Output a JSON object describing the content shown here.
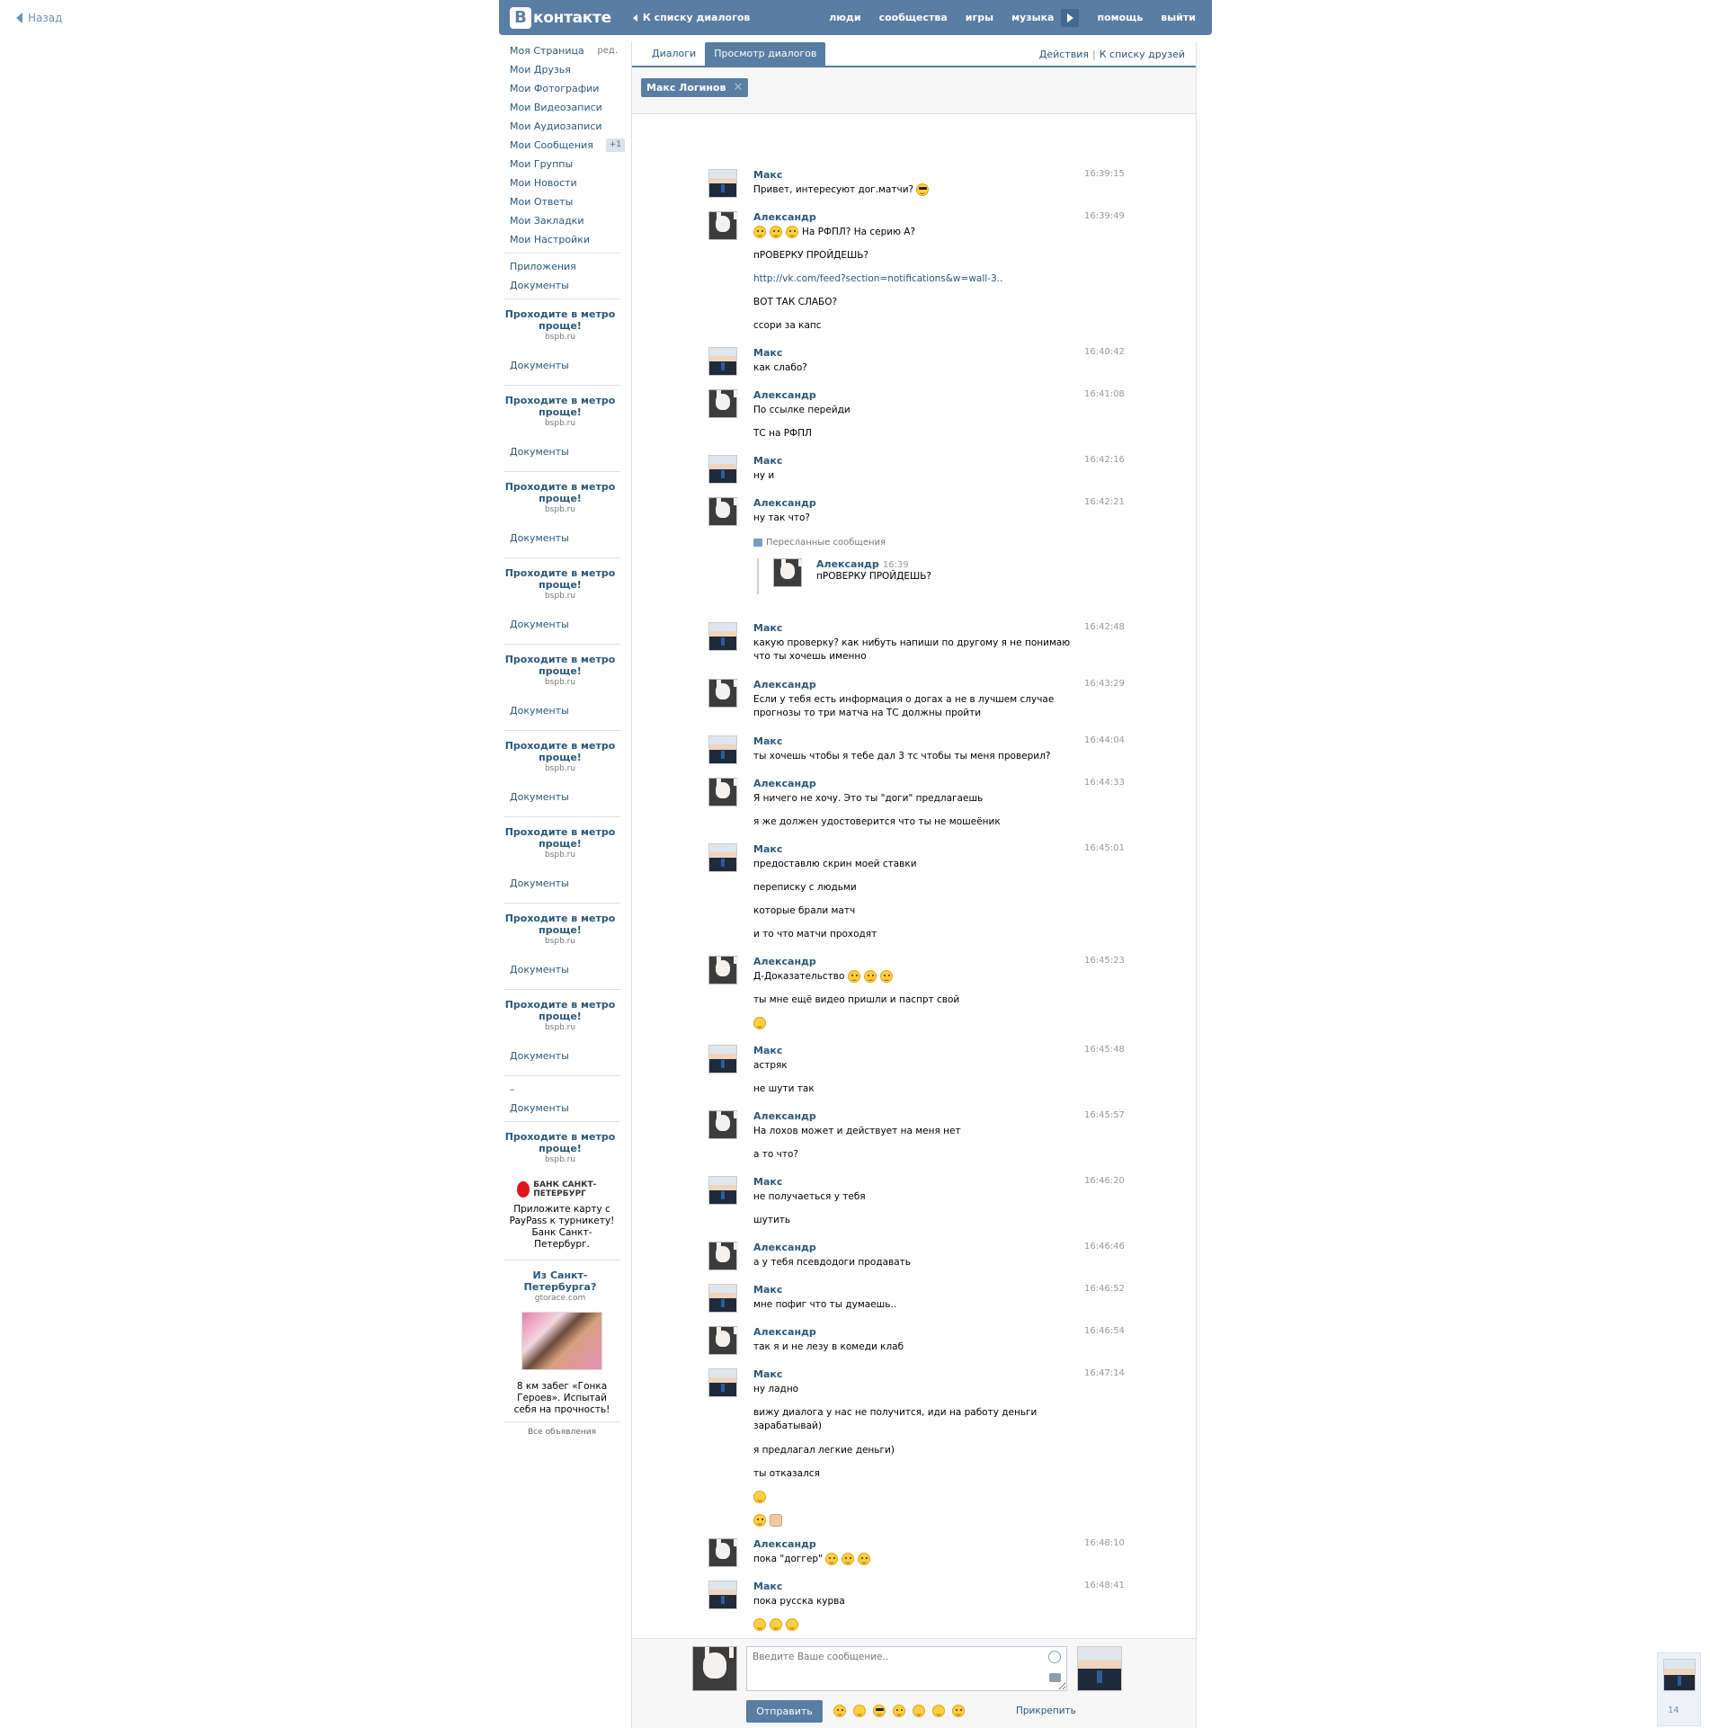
{
  "back": {
    "label": "Назад"
  },
  "header": {
    "logo_b": "В",
    "logo_text": "контакте",
    "crumb": "К списку диалогов",
    "nav": [
      "люди",
      "сообщества",
      "игры",
      "музыка",
      "помощь",
      "выйти"
    ]
  },
  "sidebar": {
    "items": [
      {
        "label": "Моя Страница",
        "extra": "ред."
      },
      {
        "label": "Мои Друзья"
      },
      {
        "label": "Мои Фотографии"
      },
      {
        "label": "Мои Видеозаписи"
      },
      {
        "label": "Мои Аудиозаписи"
      },
      {
        "label": "Мои Сообщения",
        "badge": "+1"
      },
      {
        "label": "Мои Группы"
      },
      {
        "label": "Мои Новости"
      },
      {
        "label": "Мои Ответы"
      },
      {
        "label": "Мои Закладки"
      },
      {
        "label": "Мои Настройки"
      }
    ],
    "extra_items": [
      "Приложения",
      "Документы"
    ],
    "ad_title": "Проходите в метро проще!",
    "ad_domain": "bspb.ru",
    "docs_label": "Документы",
    "dash": "–",
    "bank_name": "БАНК САНКТ-ПЕТЕРБУРГ",
    "bank_text": "Приложите карту с PayPass к турникету! Банк Санкт-Петербург.",
    "ad2_title": "Из Санкт-Петербурга?",
    "ad2_domain": "gtorace.com",
    "ad2_text": "8 км забег «Гонка Героев». Испытай себя на прочность!",
    "all_ads": "Все объявления"
  },
  "tabs": {
    "dialogs": "Диалоги",
    "view": "Просмотр диалогов",
    "actions": "Действия",
    "friends": "К списку друзей",
    "sep": "|"
  },
  "peer": {
    "name": "Макс Логинов",
    "close": "✕"
  },
  "messages": [
    {
      "author": "Макс",
      "time": "16:39:15",
      "lines": [
        "Привет, интересуют дог.матчи?"
      ]
    },
    {
      "author": "Александр",
      "time": "16:39:49",
      "lines": [
        "На РФПЛ? На серию А?",
        "пРОВЕРКУ ПРОЙДЕШЬ?",
        "http://vk.com/feed?section=notifications&w=wall-3..",
        "ВОТ ТАК СЛАБО?",
        "ссори за капс"
      ]
    },
    {
      "author": "Макс",
      "time": "16:40:42",
      "lines": [
        "как слабо?"
      ]
    },
    {
      "author": "Александр",
      "time": "16:41:08",
      "lines": [
        "По ссылке перейди",
        "ТС на РФПЛ"
      ]
    },
    {
      "author": "Макс",
      "time": "16:42:16",
      "lines": [
        "ну и"
      ]
    },
    {
      "author": "Александр",
      "time": "16:42:21",
      "lines": [
        "ну так что?"
      ]
    },
    {
      "author": "Макс",
      "time": "16:42:48",
      "lines": [
        "какую проверку? как нибуть напиши по другому я не понимаю что ты хочешь именно"
      ]
    },
    {
      "author": "Александр",
      "time": "16:43:29",
      "lines": [
        "Если у тебя есть информация о догах а не в лучшем случае прогнозы то три матча на ТС должны пройти"
      ]
    },
    {
      "author": "Макс",
      "time": "16:44:04",
      "lines": [
        "ты хочешь чтобы я тебе дал 3 тс чтобы ты меня проверил?"
      ]
    },
    {
      "author": "Александр",
      "time": "16:44:33",
      "lines": [
        "Я ничего не хочу. Это ты \"доги\" предлагаешь",
        "я же должен удостоверится что ты не мошеёник"
      ]
    },
    {
      "author": "Макс",
      "time": "16:45:01",
      "lines": [
        "предоставлю скрин моей ставки",
        "переписку с людьми",
        "которые брали матч",
        "и то что матчи проходят"
      ]
    },
    {
      "author": "Александр",
      "time": "16:45:23",
      "lines": [
        "Д-Доказательство",
        "ты мне ещё видео пришли и паспрт свой"
      ]
    },
    {
      "author": "Макс",
      "time": "16:45:48",
      "lines": [
        "астряк",
        "не шути так"
      ]
    },
    {
      "author": "Александр",
      "time": "16:45:57",
      "lines": [
        "На лохов может и действует на меня нет",
        "а то что?"
      ]
    },
    {
      "author": "Макс",
      "time": "16:46:20",
      "lines": [
        "не получаеться у тебя",
        "шутить"
      ]
    },
    {
      "author": "Александр",
      "time": "16:46:46",
      "lines": [
        "а у тебя псевдодоги продавать"
      ]
    },
    {
      "author": "Макс",
      "time": "16:46:52",
      "lines": [
        "мне пофиг что ты думаешь.."
      ]
    },
    {
      "author": "Александр",
      "time": "16:46:54",
      "lines": [
        "так я и не лезу в комеди клаб"
      ]
    },
    {
      "author": "Макс",
      "time": "16:47:14",
      "lines": [
        "ну ладно",
        "вижу диалога у нас не получится, иди на работу деньги зарабатывай)",
        "я предлагал легкие деньги)",
        "ты отказался"
      ]
    },
    {
      "author": "Александр",
      "time": "16:48:10",
      "lines": [
        "пока \"доггер\""
      ]
    },
    {
      "author": "Макс",
      "time": "16:48:41",
      "lines": [
        "пока русска курва"
      ]
    }
  ],
  "forwarded": {
    "head": "Пересланные сообщения",
    "author": "Александр",
    "time": "16:39",
    "text": "пРОВЕРКУ ПРОЙДЕШЬ?"
  },
  "compose": {
    "placeholder": "Введите Ваше сообщение..",
    "send": "Отправить",
    "attach": "Прикрепить"
  },
  "corner": {
    "count": "14"
  }
}
